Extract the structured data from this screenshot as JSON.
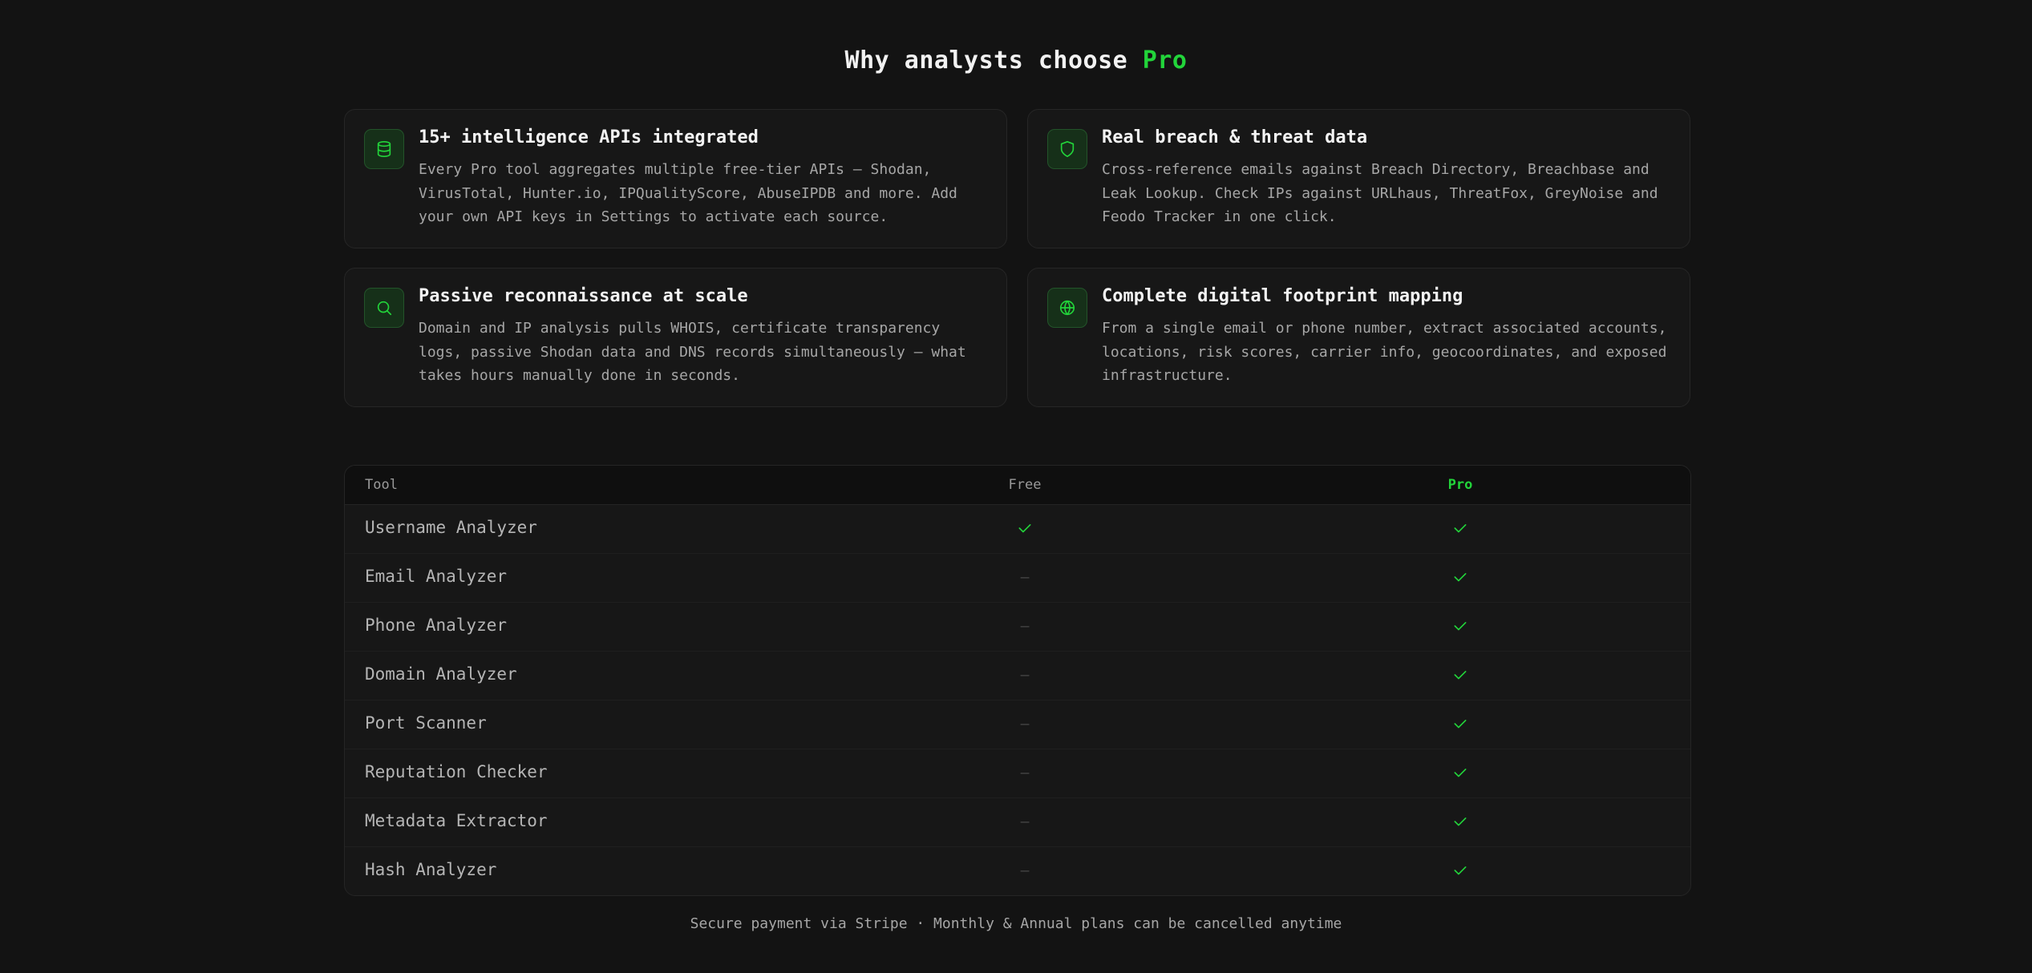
{
  "header": {
    "title_prefix": "Why analysts choose",
    "title_accent": "Pro"
  },
  "features": [
    {
      "icon": "database-icon",
      "title": "15+ intelligence APIs integrated",
      "description": "Every Pro tool aggregates multiple free-tier APIs — Shodan, VirusTotal, Hunter.io, IPQualityScore, AbuseIPDB and more. Add your own API keys in Settings to activate each source."
    },
    {
      "icon": "shield-icon",
      "title": "Real breach & threat data",
      "description": "Cross-reference emails against Breach Directory, Breachbase and Leak Lookup. Check IPs against URLhaus, ThreatFox, GreyNoise and Feodo Tracker in one click."
    },
    {
      "icon": "search-icon",
      "title": "Passive reconnaissance at scale",
      "description": "Domain and IP analysis pulls WHOIS, certificate transparency logs, passive Shodan data and DNS records simultaneously — what takes hours manually done in seconds."
    },
    {
      "icon": "globe-icon",
      "title": "Complete digital footprint mapping",
      "description": "From a single email or phone number, extract associated accounts, locations, risk scores, carrier info, geocoordinates, and exposed infrastructure."
    }
  ],
  "comparison": {
    "headers": {
      "tool": "Tool",
      "free": "Free",
      "pro": "Pro"
    },
    "rows": [
      {
        "tool": "Username Analyzer",
        "free": "check-icon",
        "pro": "check-icon"
      },
      {
        "tool": "Email Analyzer",
        "free": "—",
        "pro": "check-icon"
      },
      {
        "tool": "Phone Analyzer",
        "free": "—",
        "pro": "check-icon"
      },
      {
        "tool": "Domain Analyzer",
        "free": "—",
        "pro": "check-icon"
      },
      {
        "tool": "Port Scanner",
        "free": "—",
        "pro": "check-icon"
      },
      {
        "tool": "Reputation Checker",
        "free": "—",
        "pro": "check-icon"
      },
      {
        "tool": "Metadata Extractor",
        "free": "—",
        "pro": "check-icon"
      },
      {
        "tool": "Hash Analyzer",
        "free": "—",
        "pro": "check-icon"
      }
    ]
  },
  "footer": {
    "text": "Secure payment via Stripe · Monthly & Annual plans can be cancelled anytime"
  },
  "colors": {
    "accent": "#22d43a",
    "background": "#131313",
    "card": "#171717"
  }
}
